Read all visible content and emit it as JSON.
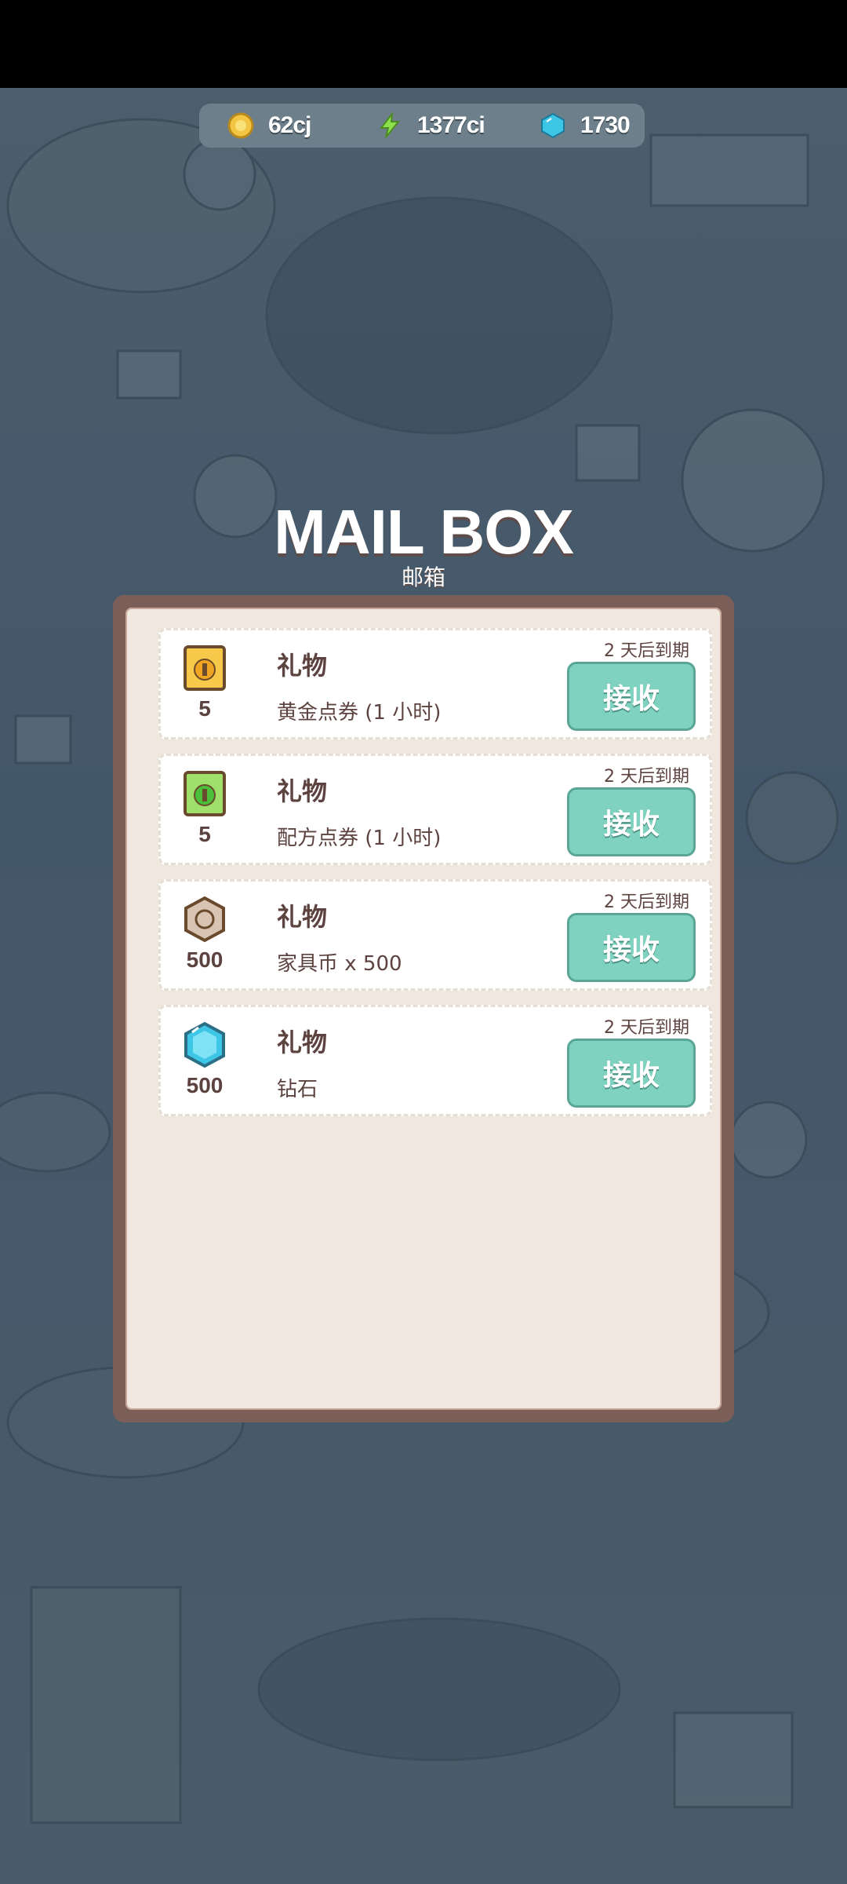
{
  "header": {
    "resources": [
      {
        "icon": "gold-coin-icon",
        "value": "62cj"
      },
      {
        "icon": "lightning-icon",
        "value": "1377ci"
      },
      {
        "icon": "diamond-icon",
        "value": "1730"
      }
    ]
  },
  "mailbox": {
    "title": "MAIL BOX",
    "subtitle": "邮箱",
    "items": [
      {
        "icon": "gold-ticket-icon",
        "quantity": "5",
        "name": "礼物",
        "description": "黄金点券 (1 小时)",
        "expire": "2 天后到期",
        "action": "接收"
      },
      {
        "icon": "green-ticket-icon",
        "quantity": "5",
        "name": "礼物",
        "description": "配方点券 (1 小时)",
        "expire": "2 天后到期",
        "action": "接收"
      },
      {
        "icon": "furniture-coin-icon",
        "quantity": "500",
        "name": "礼物",
        "description": "家具币 x 500",
        "expire": "2 天后到期",
        "action": "接收"
      },
      {
        "icon": "diamond-icon",
        "quantity": "500",
        "name": "礼物",
        "description": "钻石",
        "expire": "2 天后到期",
        "action": "接收"
      }
    ]
  },
  "colors": {
    "accent": "#7fd1c0",
    "panel_border": "#7b5e57",
    "panel_fill": "#f0e8df",
    "text": "#5d4340"
  }
}
